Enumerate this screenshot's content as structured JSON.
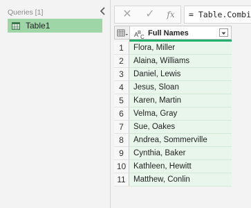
{
  "queries_pane": {
    "header": "Queries [1]",
    "items": [
      {
        "label": "Table1"
      }
    ]
  },
  "formula_bar": {
    "cancel_symbol": "✕",
    "confirm_symbol": "✓",
    "fx_label": "fx",
    "formula": "= Table.Combine"
  },
  "grid": {
    "column_header": "Full Names",
    "column_type": "text",
    "rows": [
      {
        "num": "1",
        "value": "Flora, Miller"
      },
      {
        "num": "2",
        "value": "Alaina, Williams"
      },
      {
        "num": "3",
        "value": "Daniel, Lewis"
      },
      {
        "num": "4",
        "value": "Jesus, Sloan"
      },
      {
        "num": "5",
        "value": "Karen, Martin"
      },
      {
        "num": "6",
        "value": "Velma, Gray"
      },
      {
        "num": "7",
        "value": "Sue, Oakes"
      },
      {
        "num": "8",
        "value": "Andrea, Sommerville"
      },
      {
        "num": "9",
        "value": "Cynthia, Baker"
      },
      {
        "num": "10",
        "value": "Kathleen, Hewitt"
      },
      {
        "num": "11",
        "value": "Matthew, Conlin"
      }
    ]
  },
  "colors": {
    "selected_query": "#9fd6a8",
    "quality_bar": "#22b06c",
    "cell_background": "#e8f6ec"
  }
}
